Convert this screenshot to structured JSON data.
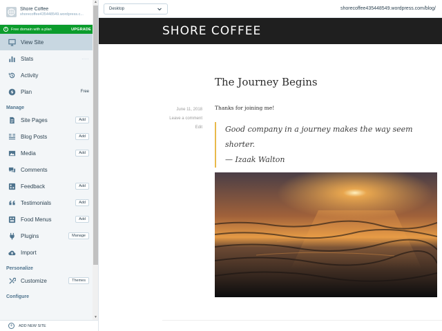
{
  "site": {
    "title": "Shore Coffee",
    "url_short": "shorecoffee435448549.wordpress.c..."
  },
  "banner": {
    "text": "Free domain with a plan",
    "action": "UPGRADE"
  },
  "menu_top": [
    {
      "name": "view-site",
      "label": "View Site",
      "icon": "desktop-icon",
      "active": true
    },
    {
      "name": "stats",
      "label": "Stats",
      "icon": "bar-chart-icon",
      "dots": "...."
    },
    {
      "name": "activity",
      "label": "Activity",
      "icon": "history-icon"
    },
    {
      "name": "plan",
      "label": "Plan",
      "icon": "lightning-icon",
      "badge": "Free"
    }
  ],
  "sections": {
    "manage": "Manage",
    "personalize": "Personalize",
    "configure": "Configure"
  },
  "menu_manage": [
    {
      "name": "site-pages",
      "label": "Site Pages",
      "icon": "page-icon",
      "button": "Add"
    },
    {
      "name": "blog-posts",
      "label": "Blog Posts",
      "icon": "posts-icon",
      "button": "Add"
    },
    {
      "name": "media",
      "label": "Media",
      "icon": "image-icon",
      "button": "Add"
    },
    {
      "name": "comments",
      "label": "Comments",
      "icon": "comment-icon"
    },
    {
      "name": "feedback",
      "label": "Feedback",
      "icon": "feedback-icon",
      "button": "Add"
    },
    {
      "name": "testimonials",
      "label": "Testimonials",
      "icon": "quote-icon",
      "button": "Add"
    },
    {
      "name": "food-menus",
      "label": "Food Menus",
      "icon": "food-menu-icon",
      "button": "Add"
    },
    {
      "name": "plugins",
      "label": "Plugins",
      "icon": "plug-icon",
      "button": "Manage"
    },
    {
      "name": "import",
      "label": "Import",
      "icon": "cloud-upload-icon"
    }
  ],
  "menu_personalize": [
    {
      "name": "customize",
      "label": "Customize",
      "icon": "tools-icon",
      "button": "Themes"
    }
  ],
  "add_new_site": "ADD NEW SITE",
  "preview": {
    "device": "Desktop",
    "url": "shorecoffee435448549.wordpress.com/blog/",
    "brand": "SHORE COFFEE",
    "post_title": "The Journey Begins",
    "post_date": "June 11, 2018",
    "leave_comment": "Leave a comment",
    "edit": "Edit",
    "intro": "Thanks for joining me!",
    "quote_line1": "Good company in a journey makes the way seem shorter.",
    "quote_line2": "— Izaak Walton"
  },
  "colors": {
    "accent_green": "#0b9c2c",
    "quote_border": "#e8b94a",
    "header_dark": "#1f1f1f"
  }
}
